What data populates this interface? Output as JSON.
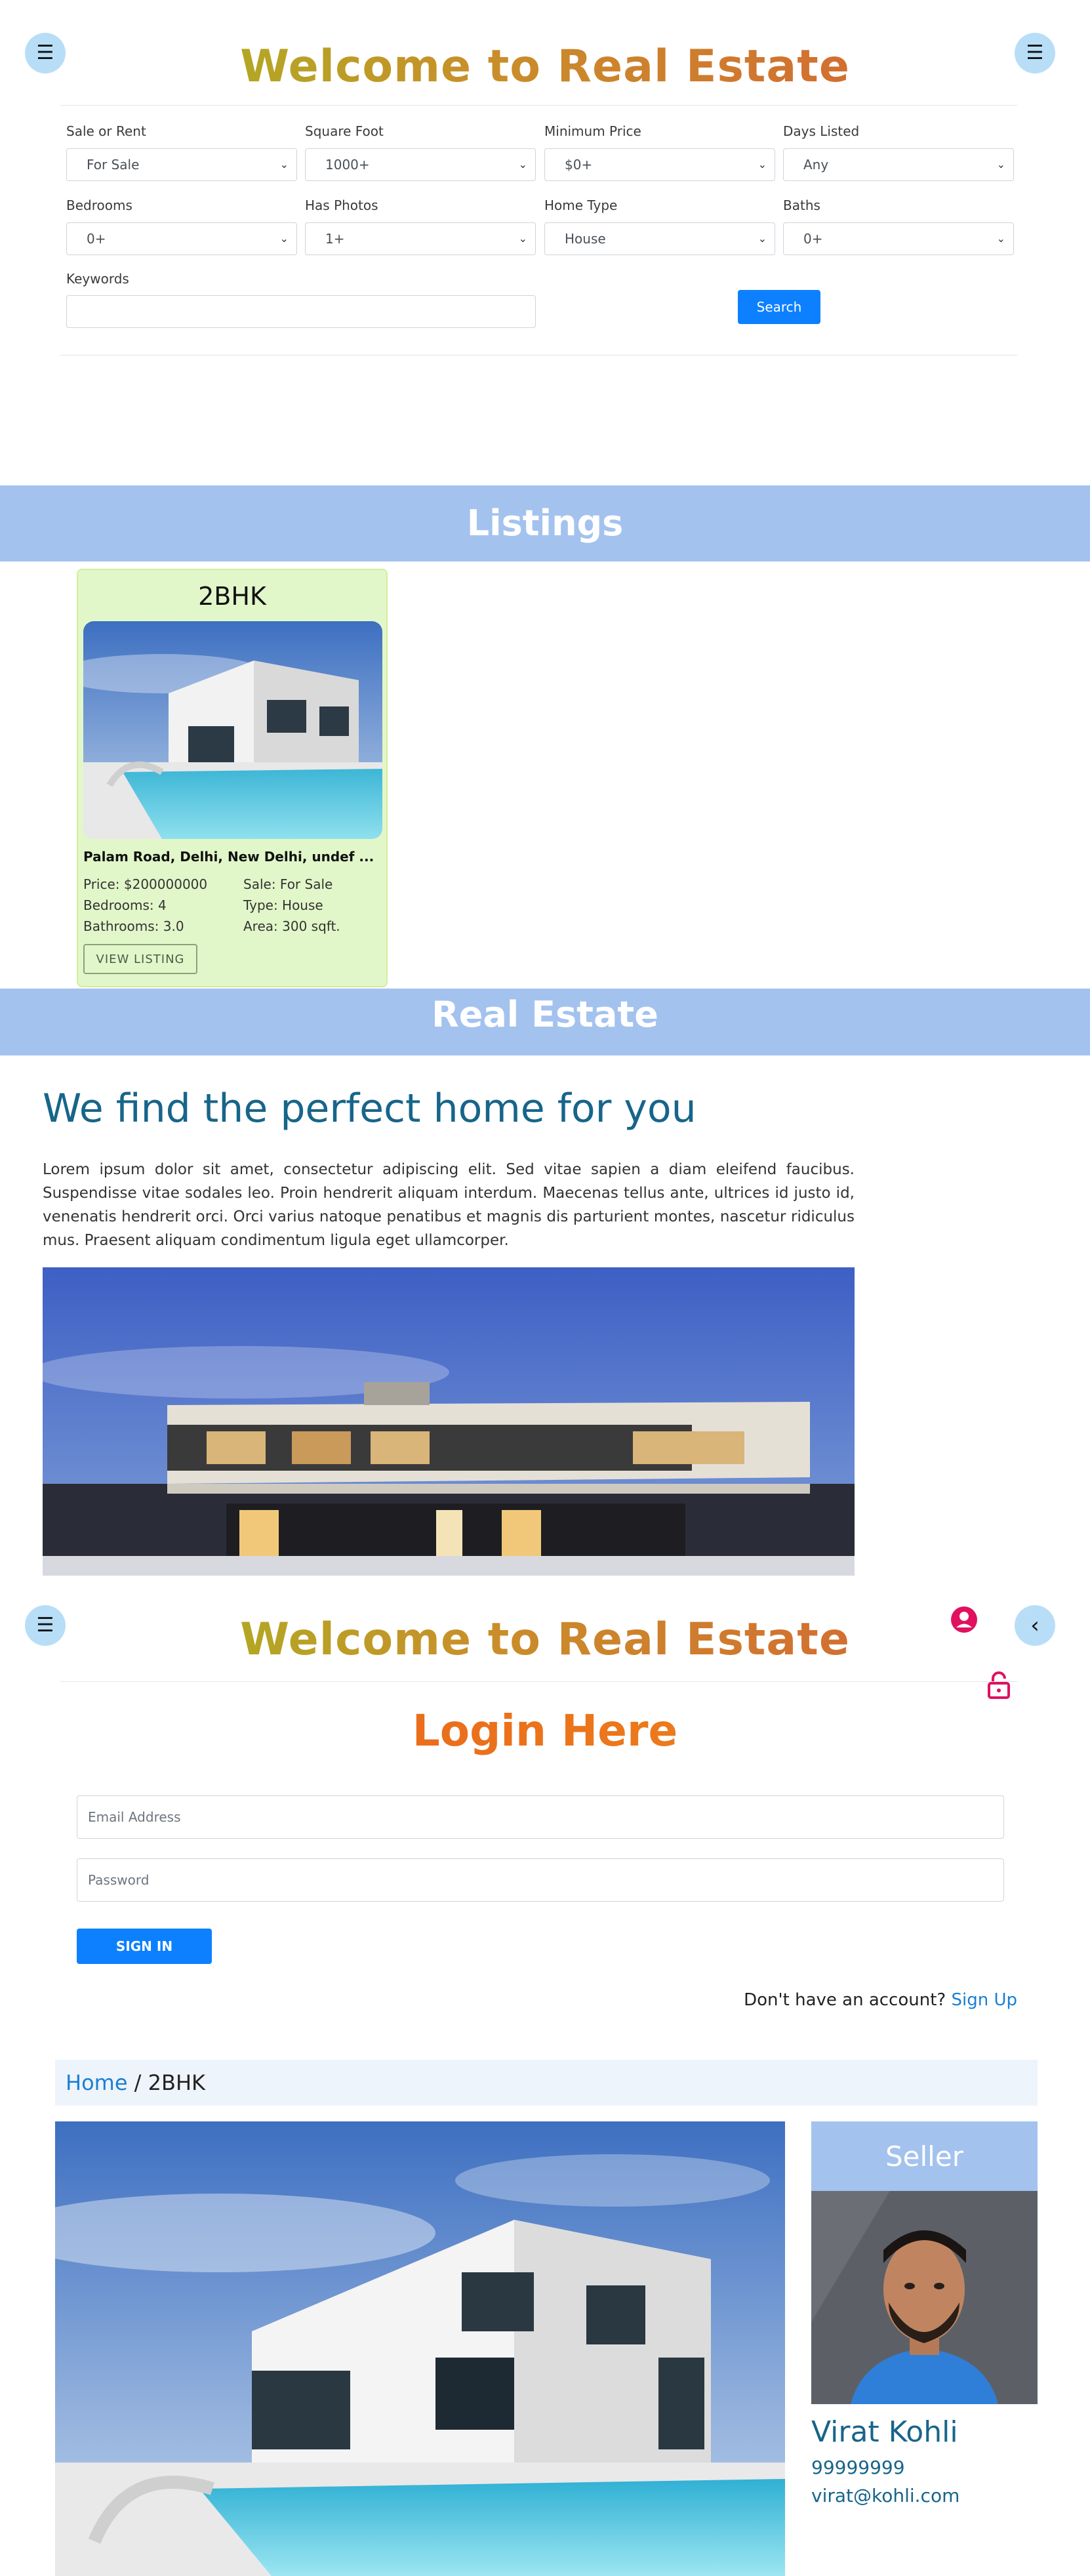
{
  "colors": {
    "accent": "#0d80ff",
    "band": "#a3c2ee",
    "card_bg": "#e2f7c9",
    "teal_text": "#17658a",
    "icon_pink": "#e0115f"
  },
  "header": {
    "title": "Welcome to Real Estate",
    "menu_icon": "hamburger-icon"
  },
  "search": {
    "sale_label": "Sale or Rent",
    "sale_value": "For Sale",
    "sqft_label": "Square Foot",
    "sqft_value": "1000+",
    "minprice_label": "Minimum Price",
    "minprice_value": "$0+",
    "days_label": "Days Listed",
    "days_value": "Any",
    "bedrooms_label": "Bedrooms",
    "bedrooms_value": "0+",
    "photos_label": "Has Photos",
    "photos_value": "1+",
    "hometype_label": "Home Type",
    "hometype_value": "House",
    "baths_label": "Baths",
    "baths_value": "0+",
    "keywords_label": "Keywords",
    "keywords_value": "",
    "search_button": "Search"
  },
  "listings": {
    "heading": "Listings",
    "items": [
      {
        "title": "2BHK",
        "address": "Palam Road, Delhi, New Delhi, undef ...",
        "price": "Price: $200000000",
        "sale": "Sale: For Sale",
        "bedrooms": "Bedrooms: 4",
        "type": "Type: House",
        "bathrooms": "Bathrooms: 3.0",
        "area": "Area: 300 sqft.",
        "button": "VIEW LISTING"
      }
    ]
  },
  "about": {
    "band_title": "Real Estate",
    "heading": "We find the perfect home for you",
    "text": "Lorem ipsum dolor sit amet, consectetur adipiscing elit. Sed vitae sapien a diam eleifend faucibus. Suspendisse vitae sodales leo. Proin hendrerit aliquam interdum. Maecenas tellus ante, ultrices id justo id, venenatis hendrerit orci. Orci varius natoque penatibus et magnis dis parturient montes, nascetur ridiculus mus. Praesent aliquam condimentum ligula eget ullamcorper."
  },
  "login": {
    "title": "Login Here",
    "email_placeholder": "Email Address",
    "password_placeholder": "Password",
    "signin_button": "SIGN IN",
    "signup_prompt": "Don't have an account?",
    "signup_link": "Sign Up"
  },
  "detail": {
    "breadcrumb_home": "Home",
    "breadcrumb_sep": " / ",
    "breadcrumb_current": "2BHK",
    "seller_heading": "Seller",
    "seller_name": "Virat Kohli",
    "seller_phone": "99999999",
    "seller_email": "virat@kohli.com"
  }
}
